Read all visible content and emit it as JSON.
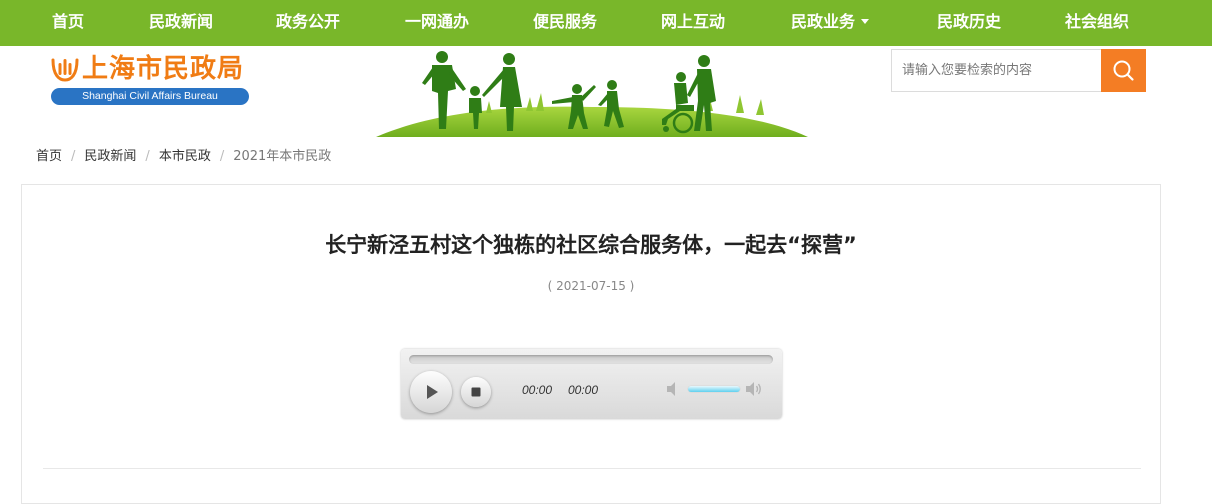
{
  "nav": {
    "items": [
      {
        "label": "首页"
      },
      {
        "label": "民政新闻"
      },
      {
        "label": "政务公开"
      },
      {
        "label": "一网通办"
      },
      {
        "label": "便民服务"
      },
      {
        "label": "网上互动"
      },
      {
        "label": "民政业务",
        "has_dropdown": true
      },
      {
        "label": "民政历史"
      },
      {
        "label": "社会组织"
      }
    ],
    "background": "#79b72a"
  },
  "logo": {
    "title": "上海市民政局",
    "subtitle": "Shanghai Civil Affairs Bureau"
  },
  "search": {
    "placeholder": "请输入您要检索的内容",
    "button_icon": "search-icon",
    "button_color": "#f47d24"
  },
  "breadcrumb": {
    "items": [
      "首页",
      "民政新闻",
      "本市民政",
      "2021年本市民政"
    ],
    "separator": "/"
  },
  "article": {
    "title": "长宁新泾五村这个独栋的社区综合服务体，一起去“探营”",
    "date": "( 2021-07-15 )"
  },
  "player": {
    "current_time": "00:00",
    "duration": "00:00",
    "progress": 0,
    "volume": 1.0
  }
}
